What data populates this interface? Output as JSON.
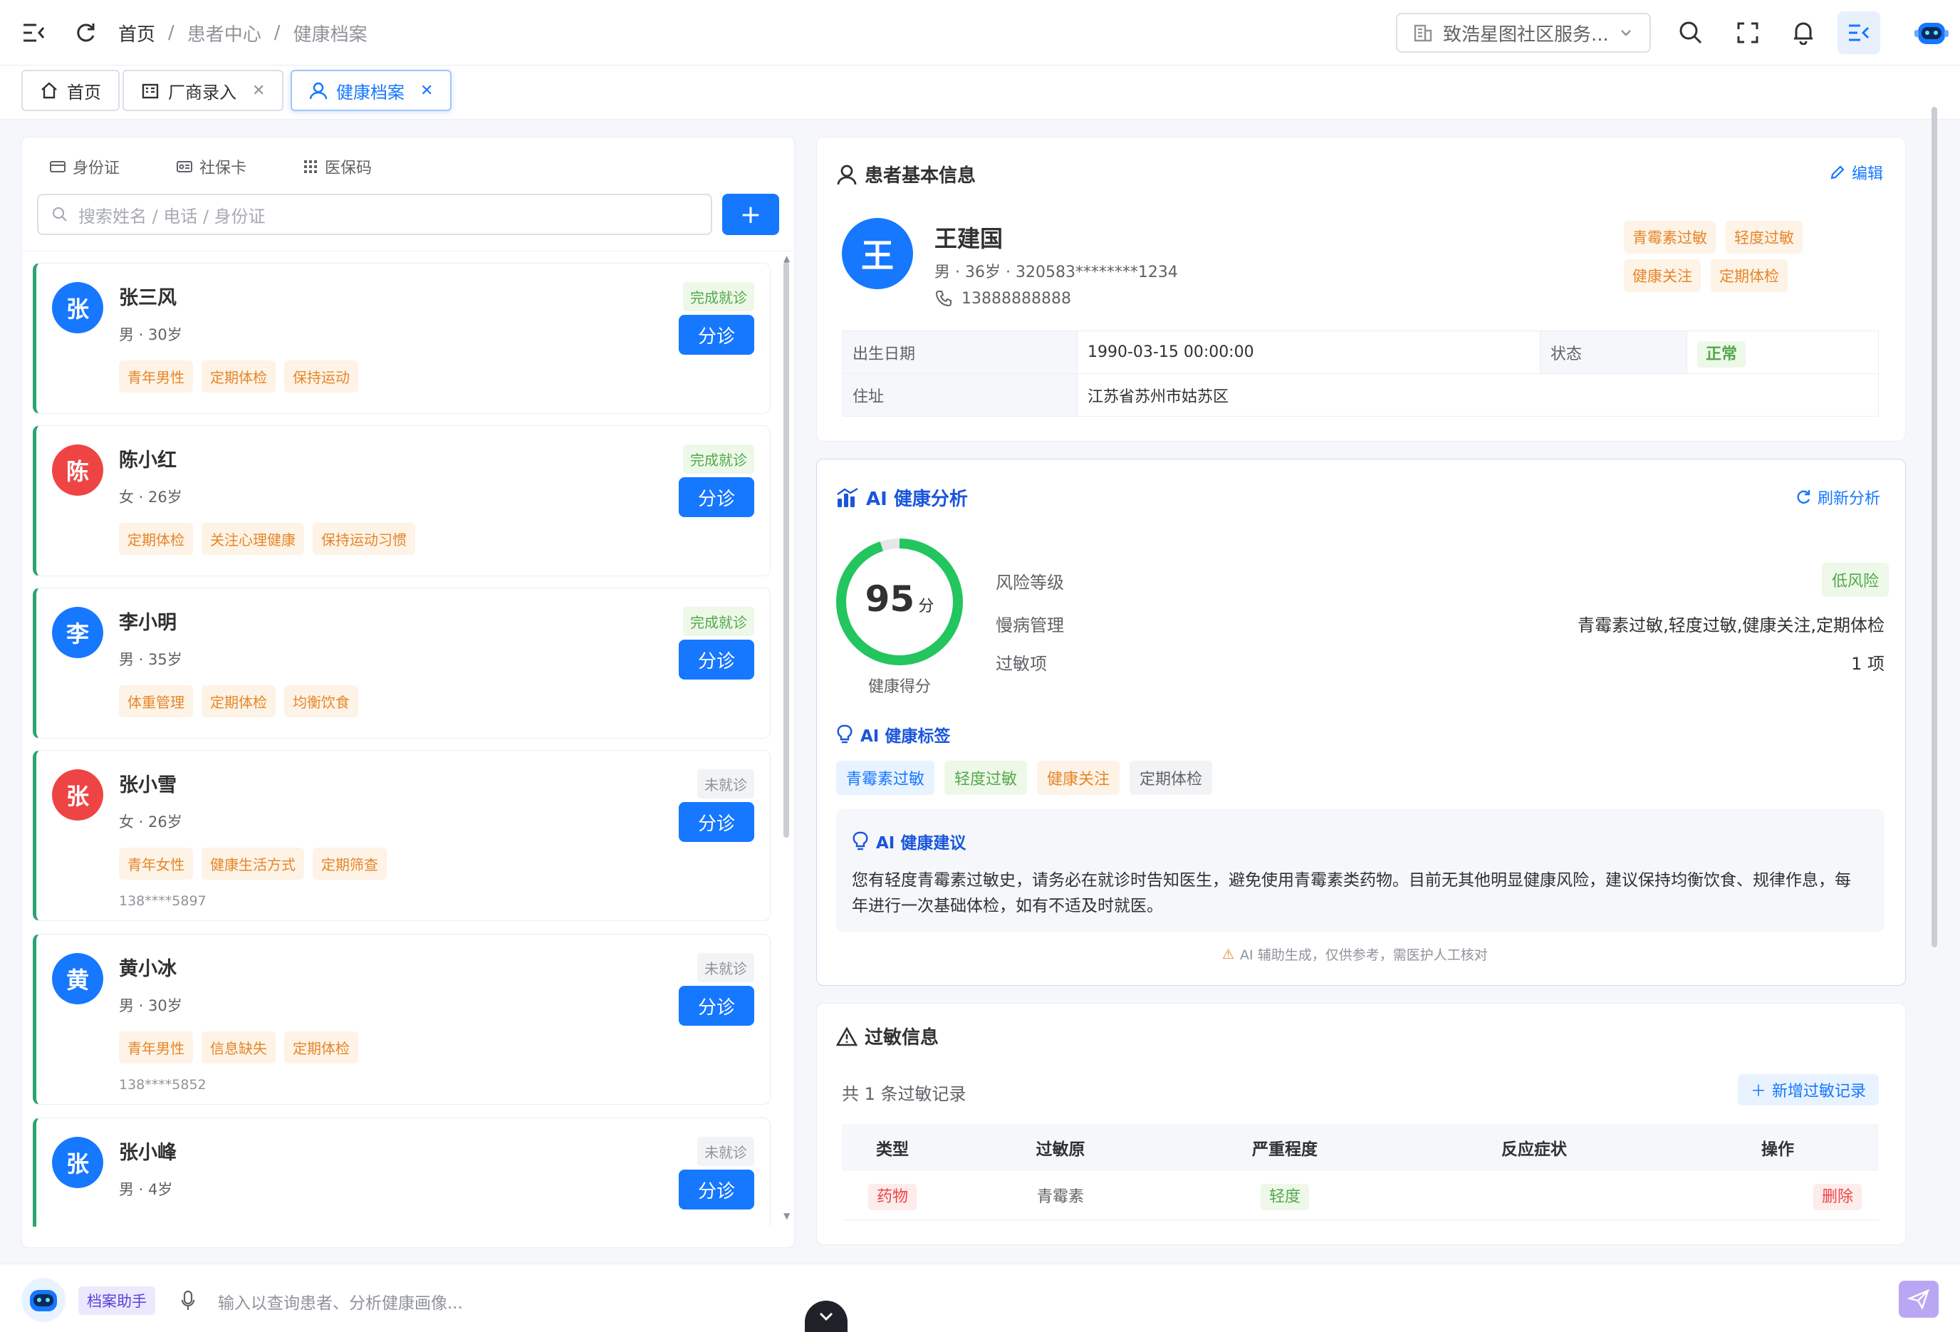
{
  "header": {
    "breadcrumb": [
      "首页",
      "患者中心",
      "健康档案"
    ],
    "org_select": "致浩星图社区服务..."
  },
  "tabs": [
    {
      "label": "首页",
      "icon": "home-icon"
    },
    {
      "label": "厂商录入",
      "icon": "building-icon",
      "closable": true
    },
    {
      "label": "健康档案",
      "icon": "user-icon",
      "closable": true,
      "active": true
    }
  ],
  "left": {
    "id_tabs": [
      "身份证",
      "社保卡",
      "医保码"
    ],
    "search_placeholder": "搜索姓名 / 电话 / 身份证",
    "add_label": "+",
    "patients": [
      {
        "avatar": "张",
        "color": "#1677ff",
        "name": "张三风",
        "meta": "男 · 30岁",
        "status": "完成就诊",
        "status_type": "done",
        "action": "分诊",
        "tags": [
          "青年男性",
          "定期体检",
          "保持运动"
        ],
        "phone": ""
      },
      {
        "avatar": "陈",
        "color": "#ef4444",
        "name": "陈小红",
        "meta": "女 · 26岁",
        "status": "完成就诊",
        "status_type": "done",
        "action": "分诊",
        "tags": [
          "定期体检",
          "关注心理健康",
          "保持运动习惯"
        ],
        "phone": ""
      },
      {
        "avatar": "李",
        "color": "#1677ff",
        "name": "李小明",
        "meta": "男 · 35岁",
        "status": "完成就诊",
        "status_type": "done",
        "action": "分诊",
        "tags": [
          "体重管理",
          "定期体检",
          "均衡饮食"
        ],
        "phone": ""
      },
      {
        "avatar": "张",
        "color": "#ef4444",
        "name": "张小雪",
        "meta": "女 · 26岁",
        "status": "未就诊",
        "status_type": "not",
        "action": "分诊",
        "tags": [
          "青年女性",
          "健康生活方式",
          "定期筛查"
        ],
        "phone": "138****5897"
      },
      {
        "avatar": "黄",
        "color": "#1677ff",
        "name": "黄小冰",
        "meta": "男 · 30岁",
        "status": "未就诊",
        "status_type": "not",
        "action": "分诊",
        "tags": [
          "青年男性",
          "信息缺失",
          "定期体检"
        ],
        "phone": "138****5852"
      },
      {
        "avatar": "张",
        "color": "#1677ff",
        "name": "张小峰",
        "meta": "男 · 4岁",
        "status": "未就诊",
        "status_type": "not",
        "action": "分诊",
        "tags": [],
        "phone": ""
      }
    ]
  },
  "patient_info": {
    "title": "患者基本信息",
    "edit_label": "编辑",
    "avatar": "王",
    "name": "王建国",
    "meta": "男 · 36岁 · 320583********1234",
    "phone": "13888888888",
    "tags": [
      "青霉素过敏",
      "轻度过敏",
      "健康关注",
      "定期体检"
    ],
    "birth_label": "出生日期",
    "birth_value": "1990-03-15 00:00:00",
    "state_label": "状态",
    "state_value": "正常",
    "address_label": "住址",
    "address_value": "江苏省苏州市姑苏区"
  },
  "ai_analysis": {
    "title": "AI 健康分析",
    "refresh_label": "刷新分析",
    "score": 95,
    "score_unit": "分",
    "score_caption": "健康得分",
    "risk_label": "风险等级",
    "risk_value": "低风险",
    "chronic_label": "慢病管理",
    "chronic_value": "青霉素过敏,轻度过敏,健康关注,定期体检",
    "allergy_label": "过敏项",
    "allergy_value": "1 项",
    "tags_title": "AI 健康标签",
    "tags": [
      {
        "text": "青霉素过敏",
        "bg": "#e8f3ff",
        "fg": "#1677ff"
      },
      {
        "text": "轻度过敏",
        "bg": "#edf8e8",
        "fg": "#52a84c"
      },
      {
        "text": "健康关注",
        "bg": "#fdf3e6",
        "fg": "#e6862a"
      },
      {
        "text": "定期体检",
        "bg": "#f2f3f5",
        "fg": "#606266"
      }
    ],
    "advice_title": "AI 健康建议",
    "advice_line1": "您有轻度青霉素过敏史，请务必在就诊时告知医生，避免使用青霉素类药物。目前无其他明显健康风险，建议保持均衡饮食、规律作息，每",
    "advice_line2": "年进行一次基础体检，如有不适及时就医。",
    "disclaimer": "AI 辅助生成，仅供参考，需医护人工核对"
  },
  "allergy": {
    "title": "过敏信息",
    "count_text": "共 1 条过敏记录",
    "add_label": "新增过敏记录",
    "columns": [
      "类型",
      "过敏原",
      "严重程度",
      "反应症状",
      "操作"
    ],
    "rows": [
      {
        "type": "药物",
        "allergen": "青霉素",
        "severity": "轻度",
        "symptom": "",
        "action": "删除"
      }
    ]
  },
  "chat": {
    "assistant_label": "档案助手",
    "placeholder": "输入以查询患者、分析健康画像..."
  },
  "colors": {
    "primary": "#1677ff",
    "success": "#22c55e",
    "warning": "#e6862a",
    "danger": "#ef4444"
  }
}
